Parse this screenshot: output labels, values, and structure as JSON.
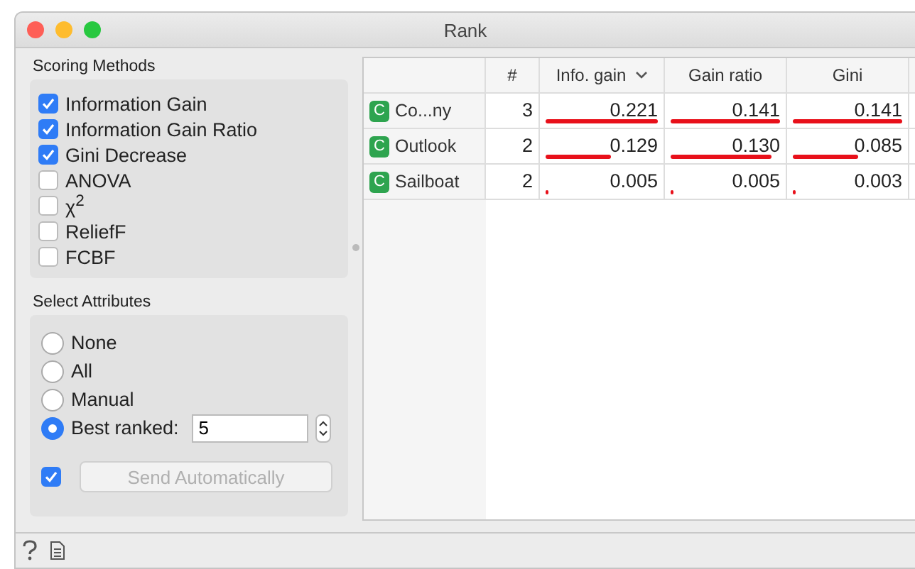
{
  "window": {
    "title": "Rank"
  },
  "scoring_methods": {
    "title": "Scoring Methods",
    "items": [
      {
        "label": "Information Gain",
        "checked": true
      },
      {
        "label": "Information Gain Ratio",
        "checked": true
      },
      {
        "label": "Gini Decrease",
        "checked": true
      },
      {
        "label": "ANOVA",
        "checked": false
      },
      {
        "label": "χ$^{2}$",
        "checked": false
      },
      {
        "label": "ReliefF",
        "checked": false
      },
      {
        "label": "FCBF",
        "checked": false
      }
    ]
  },
  "select_attributes": {
    "title": "Select Attributes",
    "options": [
      {
        "label": "None",
        "selected": false
      },
      {
        "label": "All",
        "selected": false
      },
      {
        "label": "Manual",
        "selected": false
      },
      {
        "label": "Best ranked:",
        "selected": true
      }
    ],
    "best_ranked_value": "5",
    "send_automatically": {
      "checked": true,
      "label": "Send Automatically",
      "disabled": true
    }
  },
  "table": {
    "columns": [
      {
        "label": "#",
        "sorted": false
      },
      {
        "label": "Info. gain",
        "sorted": true
      },
      {
        "label": "Gain ratio",
        "sorted": false
      },
      {
        "label": "Gini",
        "sorted": false
      }
    ],
    "rows": [
      {
        "badge": "C",
        "name": "Co...ny",
        "cells": [
          {
            "value": "3"
          },
          {
            "value": "0.221",
            "level": 1
          },
          {
            "value": "0.141",
            "level": 1
          },
          {
            "value": "0.141",
            "level": 1
          }
        ]
      },
      {
        "badge": "C",
        "name": "Outlook",
        "cells": [
          {
            "value": "2"
          },
          {
            "value": "0.129",
            "level": 0.58
          },
          {
            "value": "0.130",
            "level": 0.92
          },
          {
            "value": "0.085",
            "level": 0.6
          }
        ]
      },
      {
        "badge": "C",
        "name": "Sailboat",
        "cells": [
          {
            "value": "2"
          },
          {
            "value": "0.005",
            "level": 0.02
          },
          {
            "value": "0.005",
            "level": 0.02
          },
          {
            "value": "0.003",
            "level": 0.02
          }
        ]
      }
    ]
  }
}
